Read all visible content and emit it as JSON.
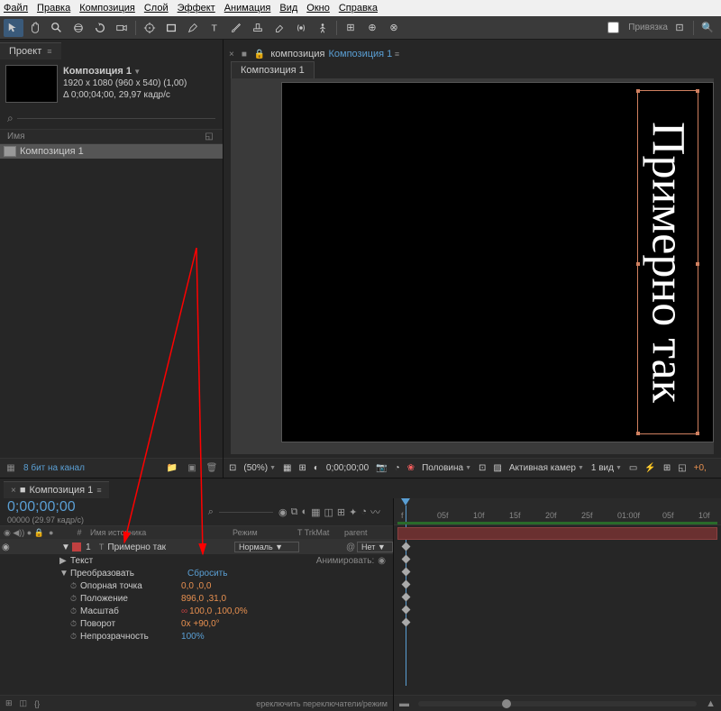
{
  "menu": {
    "file": "Файл",
    "edit": "Правка",
    "composition": "Композиция",
    "layer": "Слой",
    "effect": "Эффект",
    "animation": "Анимация",
    "view": "Вид",
    "window": "Окно",
    "help": "Справка"
  },
  "toolbar": {
    "snap": "Привязка"
  },
  "project": {
    "tab": "Проект",
    "comp_name": "Композиция 1",
    "dims": "1920 x 1080  (960 x 540) (1,00)",
    "duration": "Δ 0;00;04;00, 29,97 кадр/с",
    "name_col": "Имя",
    "item": "Композиция 1",
    "bpc": "8 бит на канал"
  },
  "viewer": {
    "prefix": "композиция",
    "name": "Композиция 1",
    "subtab": "Композиция 1",
    "text": "Примерно так",
    "footer": {
      "zoom": "(50%)",
      "timecode": "0;00;00;00",
      "quality": "Половина",
      "camera": "Активная камер",
      "view": "1 вид"
    }
  },
  "timeline": {
    "tab": "Композиция 1",
    "timecode": "0;00;00;00",
    "timecode_sub": "00000 (29.97 кадр/с)",
    "hdr": {
      "num": "#",
      "name": "Имя источника",
      "mode": "Режим",
      "trkmat": "T  TrkMat",
      "parent": "parent"
    },
    "layer": {
      "num": "1",
      "name": "Примерно так",
      "mode": "Нормаль",
      "trkmat": "",
      "parent": "Нет"
    },
    "groups": {
      "text": "Текст",
      "transform": "Преобразовать",
      "animate": "Анимировать:"
    },
    "reset": "Сбросить",
    "props": {
      "anchor": {
        "name": "Опорная точка",
        "val": "0,0 ,0,0"
      },
      "position": {
        "name": "Положение",
        "val": "896,0 ,31,0"
      },
      "scale": {
        "name": "Масштаб",
        "val": "100,0 ,100,0%",
        "link": "∞"
      },
      "rotation": {
        "name": "Поворот",
        "val": "0x +90,0°"
      },
      "opacity": {
        "name": "Непрозрачность",
        "val": "100%"
      }
    },
    "ruler": [
      "f",
      "05f",
      "10f",
      "15f",
      "20f",
      "25f",
      "01:00f",
      "05f",
      "10f"
    ],
    "footer": "ереключить переключатели/режим"
  }
}
